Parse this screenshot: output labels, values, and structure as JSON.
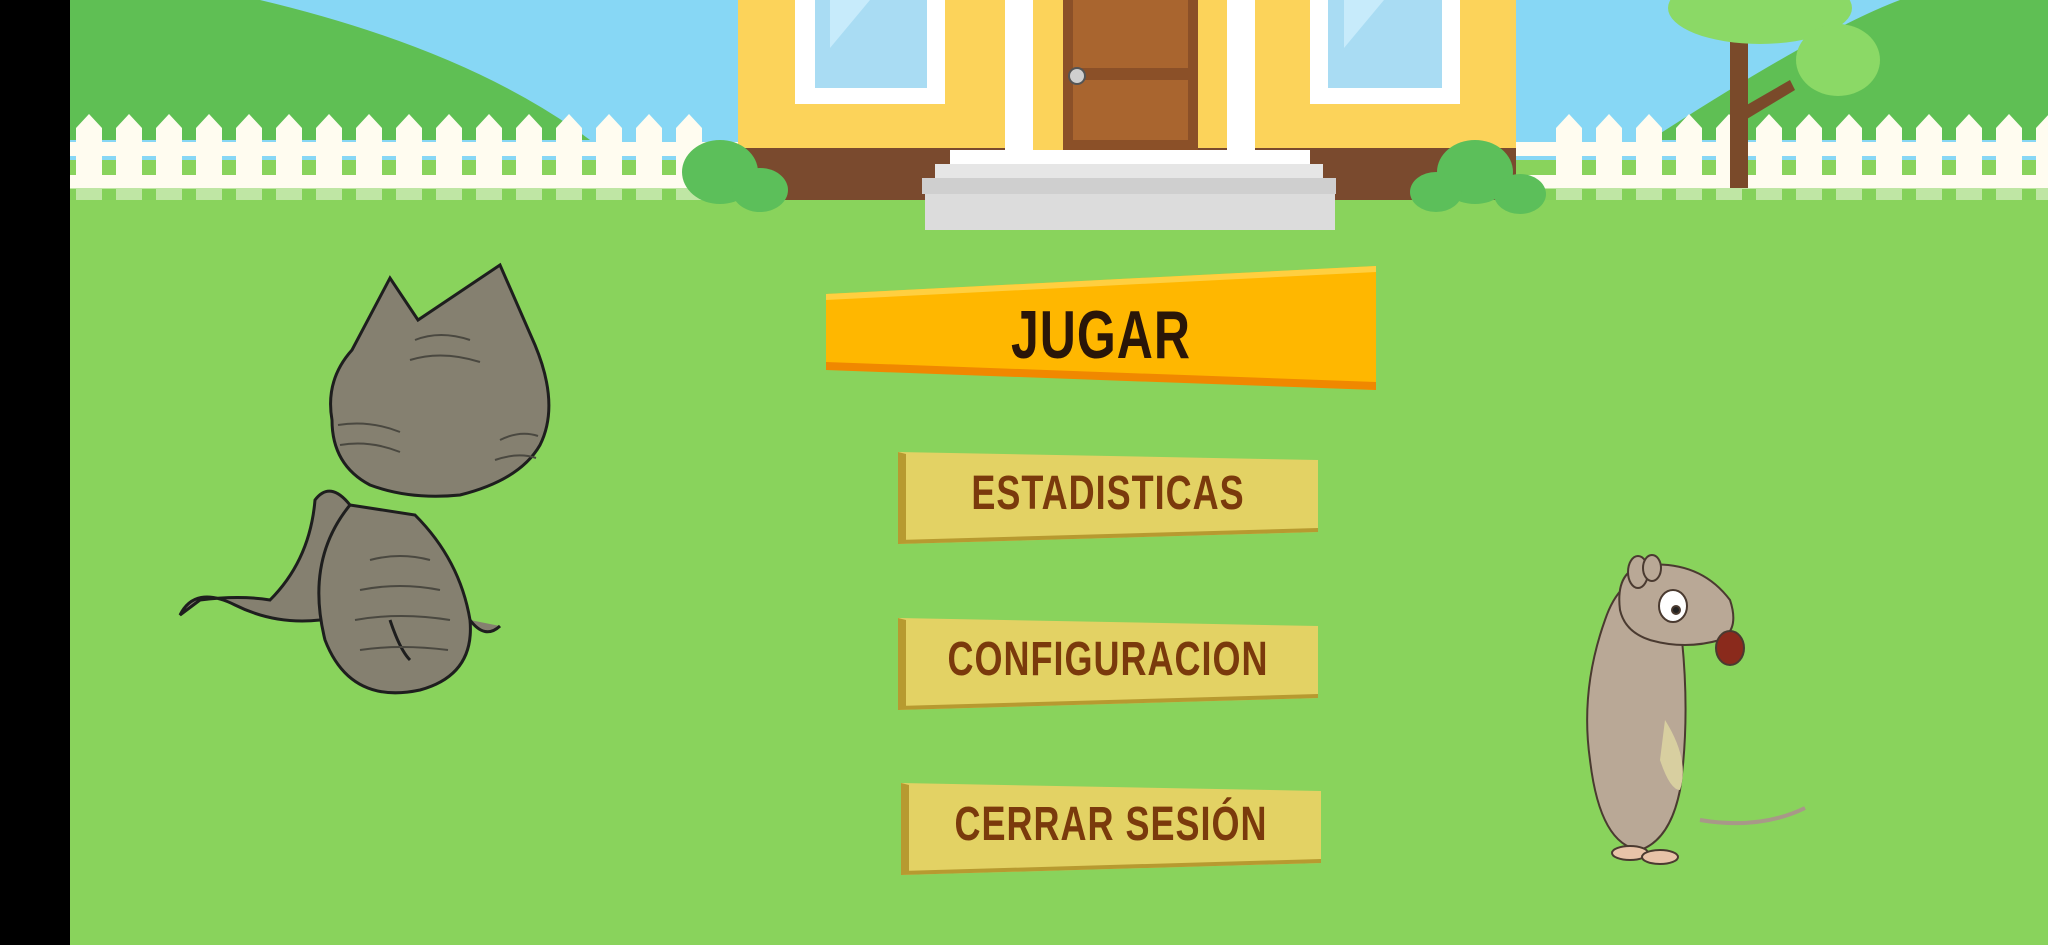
{
  "menu": {
    "play_label": "JUGAR",
    "stats_label": "ESTADISTICAS",
    "config_label": "CONFIGURACION",
    "logout_label": "CERRAR SESIÓN"
  },
  "colors": {
    "grass": "#89d35c",
    "sky": "#87d7f5",
    "hills": "#5fbf54",
    "house_wall": "#fcd35a",
    "play_button": "#ffb700",
    "menu_button": "#e3d264",
    "menu_text": "#7a3a0c"
  }
}
